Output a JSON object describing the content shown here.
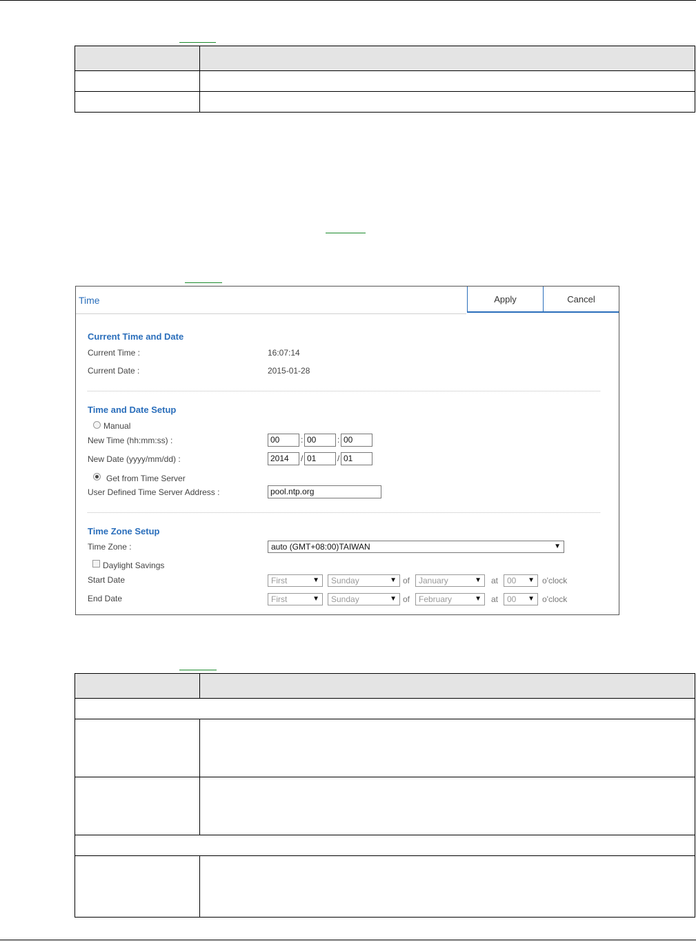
{
  "panel": {
    "title": "Time",
    "apply_label": "Apply",
    "cancel_label": "Cancel",
    "current": {
      "heading": "Current Time and Date",
      "time_label": "Current Time :",
      "time_value": "16:07:14",
      "date_label": "Current Date :",
      "date_value": "2015-01-28"
    },
    "setup": {
      "heading": "Time and Date Setup",
      "manual_label": "Manual",
      "new_time_label": "New Time (hh:mm:ss) :",
      "hh": "00",
      "mm": "00",
      "ss": "00",
      "new_date_label": "New Date (yyyy/mm/dd) :",
      "yyyy": "2014",
      "month": "01",
      "day": "01",
      "server_option_label": "Get from Time Server",
      "server_address_label": "User Defined Time Server Address :",
      "server_address": "pool.ntp.org"
    },
    "tz": {
      "heading": "Time Zone Setup",
      "zone_label": "Time Zone :",
      "zone_value": "auto (GMT+08:00)TAIWAN",
      "dst_label": "Daylight Savings",
      "start_label": "Start Date",
      "end_label": "End Date",
      "start": {
        "week": "First",
        "day": "Sunday",
        "month": "January",
        "hour": "00"
      },
      "end": {
        "week": "First",
        "day": "Sunday",
        "month": "February",
        "hour": "00"
      },
      "of_label": "of",
      "at_label": "at",
      "oclock_label": "o'clock"
    }
  },
  "colors": {
    "accent": "#2a6ebb",
    "link": "#1a8a2a",
    "table_header": "#e4e4e4"
  }
}
